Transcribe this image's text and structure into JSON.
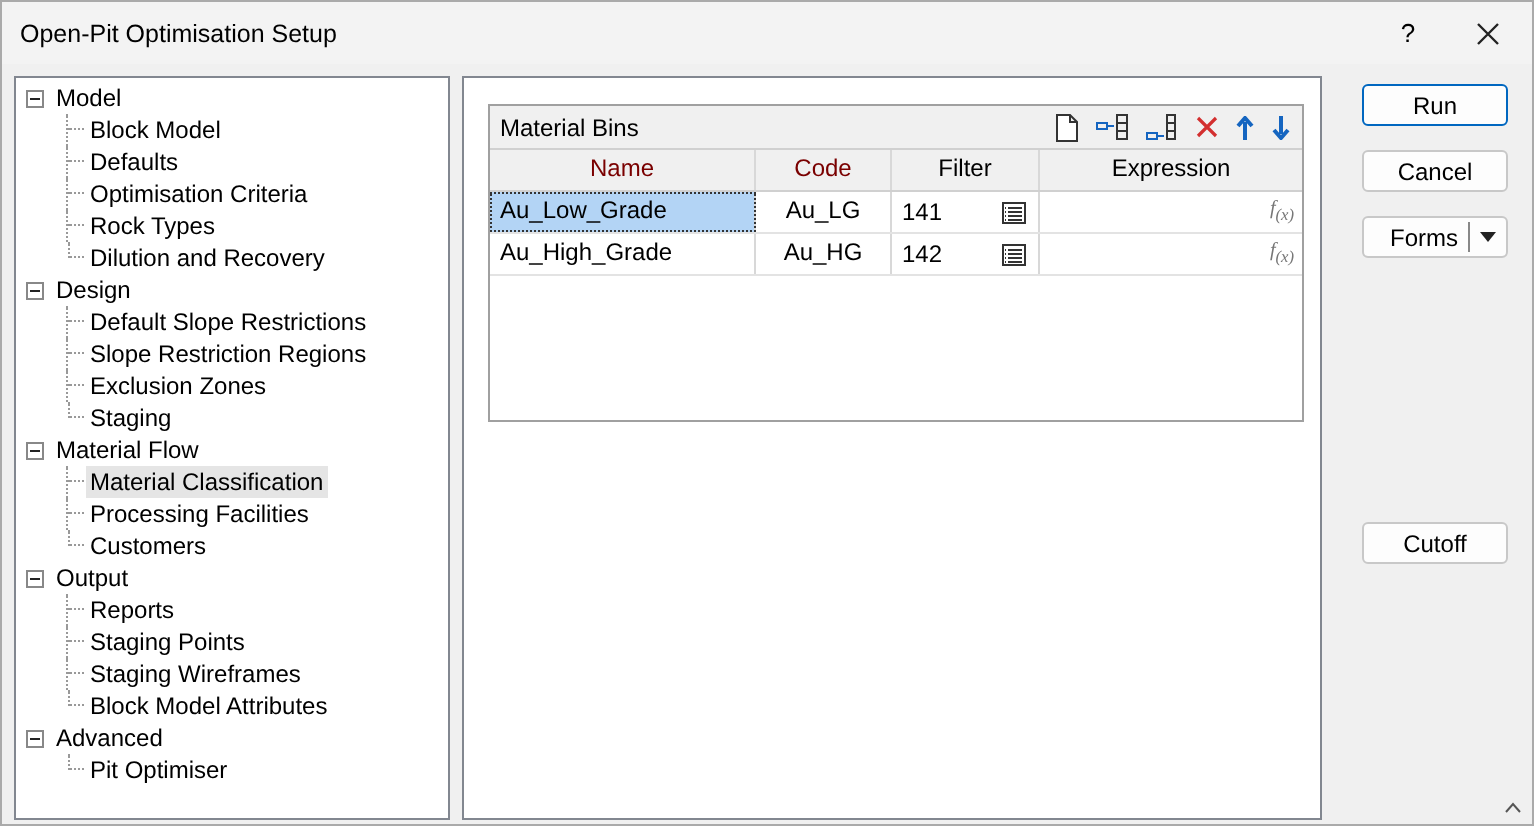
{
  "window": {
    "title": "Open-Pit Optimisation Setup",
    "help": "?"
  },
  "tree": [
    {
      "label": "Model",
      "expanded": true,
      "selected": false,
      "children": [
        {
          "label": "Block Model",
          "selected": false
        },
        {
          "label": "Defaults",
          "selected": false
        },
        {
          "label": "Optimisation Criteria",
          "selected": false
        },
        {
          "label": "Rock Types",
          "selected": false
        },
        {
          "label": "Dilution and Recovery",
          "selected": false
        }
      ]
    },
    {
      "label": "Design",
      "expanded": true,
      "selected": false,
      "children": [
        {
          "label": "Default Slope Restrictions",
          "selected": false
        },
        {
          "label": "Slope Restriction Regions",
          "selected": false
        },
        {
          "label": "Exclusion Zones",
          "selected": false
        },
        {
          "label": "Staging",
          "selected": false
        }
      ]
    },
    {
      "label": "Material Flow",
      "expanded": true,
      "selected": false,
      "children": [
        {
          "label": "Material Classification",
          "selected": true
        },
        {
          "label": "Processing Facilities",
          "selected": false
        },
        {
          "label": "Customers",
          "selected": false
        }
      ]
    },
    {
      "label": "Output",
      "expanded": true,
      "selected": false,
      "children": [
        {
          "label": "Reports",
          "selected": false
        },
        {
          "label": "Staging Points",
          "selected": false
        },
        {
          "label": "Staging Wireframes",
          "selected": false
        },
        {
          "label": "Block Model Attributes",
          "selected": false
        }
      ]
    },
    {
      "label": "Advanced",
      "expanded": true,
      "selected": false,
      "children": [
        {
          "label": "Pit Optimiser",
          "selected": false
        }
      ]
    }
  ],
  "grid": {
    "title": "Material Bins",
    "columns": [
      {
        "label": "Name",
        "required": true
      },
      {
        "label": "Code",
        "required": true
      },
      {
        "label": "Filter",
        "required": false
      },
      {
        "label": "Expression",
        "required": false
      }
    ],
    "rows": [
      {
        "name": "Au_Low_Grade",
        "code": "Au_LG",
        "filter": "141",
        "expression_icon": "f$_{(x)}$",
        "selected": true
      },
      {
        "name": "Au_High_Grade",
        "code": "Au_HG",
        "filter": "142",
        "expression_icon": "f$_{(x)}$",
        "selected": false
      }
    ]
  },
  "buttons": [
    {
      "label": "Run",
      "kind": "default"
    },
    {
      "label": "Cancel",
      "kind": "plain"
    },
    {
      "label": "Forms",
      "kind": "split"
    }
  ],
  "extra_buttons": [
    {
      "label": "Cutoff"
    }
  ]
}
